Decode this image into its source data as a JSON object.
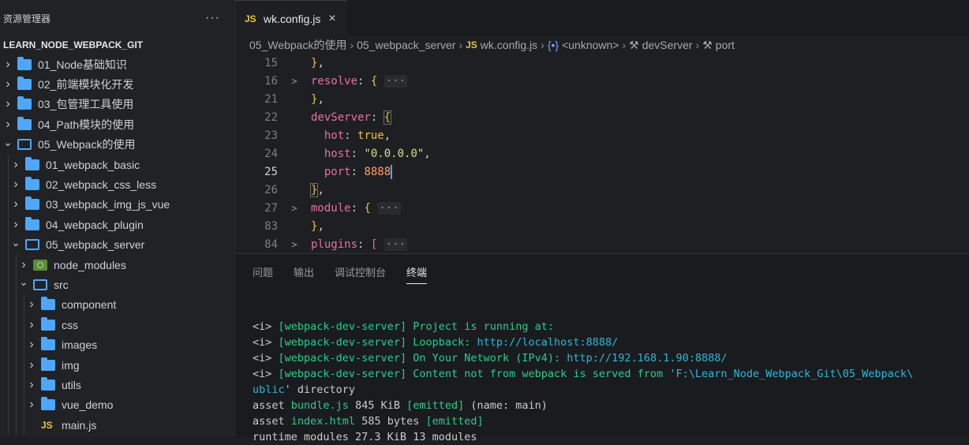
{
  "sidebar": {
    "title": "资源管理器",
    "more": "···",
    "project": "LEARN_NODE_WEBPACK_GIT",
    "items": [
      {
        "label": "01_Node基础知识",
        "depth": 0,
        "state": "closed",
        "type": "folder"
      },
      {
        "label": "02_前端模块化开发",
        "depth": 0,
        "state": "closed",
        "type": "folder"
      },
      {
        "label": "03_包管理工具使用",
        "depth": 0,
        "state": "closed",
        "type": "folder"
      },
      {
        "label": "04_Path模块的使用",
        "depth": 0,
        "state": "closed",
        "type": "folder"
      },
      {
        "label": "05_Webpack的使用",
        "depth": 0,
        "state": "open",
        "type": "folder"
      },
      {
        "label": "01_webpack_basic",
        "depth": 1,
        "state": "closed",
        "type": "folder"
      },
      {
        "label": "02_webpack_css_less",
        "depth": 1,
        "state": "closed",
        "type": "folder"
      },
      {
        "label": "03_webpack_img_js_vue",
        "depth": 1,
        "state": "closed",
        "type": "folder"
      },
      {
        "label": "04_webpack_plugin",
        "depth": 1,
        "state": "closed",
        "type": "folder"
      },
      {
        "label": "05_webpack_server",
        "depth": 1,
        "state": "open",
        "type": "folder"
      },
      {
        "label": "node_modules",
        "depth": 2,
        "state": "closed",
        "type": "node"
      },
      {
        "label": "src",
        "depth": 2,
        "state": "open",
        "type": "folder"
      },
      {
        "label": "component",
        "depth": 3,
        "state": "closed",
        "type": "folder"
      },
      {
        "label": "css",
        "depth": 3,
        "state": "closed",
        "type": "folder"
      },
      {
        "label": "images",
        "depth": 3,
        "state": "closed",
        "type": "folder"
      },
      {
        "label": "img",
        "depth": 3,
        "state": "closed",
        "type": "folder"
      },
      {
        "label": "utils",
        "depth": 3,
        "state": "closed",
        "type": "folder"
      },
      {
        "label": "vue_demo",
        "depth": 3,
        "state": "closed",
        "type": "folder"
      },
      {
        "label": "main.js",
        "depth": 3,
        "state": "none",
        "type": "js"
      }
    ]
  },
  "tab": {
    "icon": "JS",
    "label": "wk.config.js",
    "close": "×"
  },
  "breadcrumb": [
    {
      "label": "05_Webpack的使用",
      "icon": ""
    },
    {
      "label": "05_webpack_server",
      "icon": ""
    },
    {
      "label": "wk.config.js",
      "icon": "JS"
    },
    {
      "label": "<unknown>",
      "icon": "{•}"
    },
    {
      "label": "devServer",
      "icon": "🔧"
    },
    {
      "label": "port",
      "icon": "🔧"
    }
  ],
  "code": {
    "lines": [
      {
        "num": "15",
        "fold": "",
        "active": false
      },
      {
        "num": "16",
        "fold": ">",
        "active": false
      },
      {
        "num": "21",
        "fold": "",
        "active": false
      },
      {
        "num": "22",
        "fold": "",
        "active": false
      },
      {
        "num": "23",
        "fold": "",
        "active": false
      },
      {
        "num": "24",
        "fold": "",
        "active": false
      },
      {
        "num": "25",
        "fold": "",
        "active": true
      },
      {
        "num": "26",
        "fold": "",
        "active": false
      },
      {
        "num": "27",
        "fold": ">",
        "active": false
      },
      {
        "num": "83",
        "fold": "",
        "active": false
      },
      {
        "num": "84",
        "fold": ">",
        "active": false
      }
    ],
    "t": {
      "l15_close": "}",
      "l15_comma": ",",
      "l16_key": "resolve",
      "l16_colon": ": ",
      "l16_brace": "{",
      "l16_dots": "···",
      "l21_close": "}",
      "l21_comma": ",",
      "l22_key": "devServer",
      "l22_colon": ": ",
      "l22_brace": "{",
      "l23_key": "hot",
      "l23_colon": ": ",
      "l23_val": "true",
      "l23_comma": ",",
      "l24_key": "host",
      "l24_colon": ": ",
      "l24_val": "\"0.0.0.0\"",
      "l24_comma": ",",
      "l25_key": "port",
      "l25_colon": ": ",
      "l25_val": "8888",
      "l26_close": "}",
      "l26_comma": ",",
      "l27_key": "module",
      "l27_colon": ": ",
      "l27_brace": "{",
      "l27_dots": "···",
      "l83_close": "}",
      "l83_comma": ",",
      "l84_key": "plugins",
      "l84_colon": ": ",
      "l84_brace": "[",
      "l84_dots": "···"
    }
  },
  "panel": {
    "tabs": [
      "问题",
      "输出",
      "调试控制台",
      "终端"
    ],
    "active_tab": "终端"
  },
  "terminal": {
    "prefix": "<i> ",
    "tag": "[webpack-dev-server]",
    "l1": " Project is running at:",
    "l2_text": " Loopback: ",
    "l2_url": "http://localhost:8888/",
    "l3_text": " On Your Network (IPv4): ",
    "l3_url": "http://192.168.1.90:8888/",
    "l4_text": " Content not from webpack is served from ",
    "l4_path": "'F:\\Learn_Node_Webpack_Git\\05_Webpack\\",
    "l5_a": "ublic",
    "l5_b": "' directory",
    "l6_a": "asset ",
    "l6_b": "bundle.js",
    "l6_c": " 845 KiB ",
    "l6_d": "[emitted]",
    "l6_e": " (name: main)",
    "l7_a": "asset ",
    "l7_b": "index.html",
    "l7_c": " 585 bytes ",
    "l7_d": "[emitted]",
    "l8": "runtime modules 27.3 KiB 13 modules"
  },
  "colors": {
    "accent": "#4fa6ff",
    "js": "#e8c53c",
    "terminal_green": "#23d18b",
    "terminal_cyan": "#29b8db"
  }
}
